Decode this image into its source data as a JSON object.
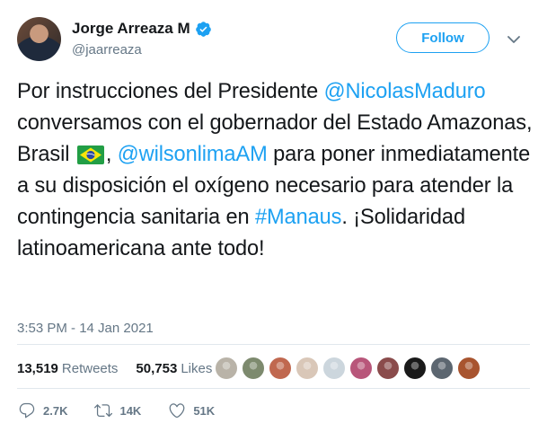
{
  "user": {
    "name": "Jorge Arreaza M",
    "handle": "@jaarreaza",
    "verified": true
  },
  "follow_button": {
    "label": "Follow"
  },
  "tweet": {
    "segments": [
      {
        "text": "Por instrucciones del Presidente ",
        "type": "text"
      },
      {
        "text": "@NicolasMaduro",
        "type": "mention"
      },
      {
        "text": " conversamos con el gobernador del Estado Amazonas, Brasil ",
        "type": "text"
      },
      {
        "text": "",
        "type": "flag-brazil"
      },
      {
        "text": ", ",
        "type": "text"
      },
      {
        "text": "@wilsonlimaAM",
        "type": "mention"
      },
      {
        "text": " para poner inmediatamente a su disposición el oxígeno necesario para atender la contingencia sanitaria en ",
        "type": "text"
      },
      {
        "text": "#Manaus",
        "type": "hashtag"
      },
      {
        "text": ". ¡Solidaridad latinoamericana ante todo!",
        "type": "text"
      }
    ],
    "timestamp": "3:53 PM - 14 Jan 2021"
  },
  "stats": {
    "retweets_count": "13,519",
    "retweets_label": "Retweets",
    "likes_count": "50,753",
    "likes_label": "Likes"
  },
  "liker_avatar_colors": [
    "#b9b3a8",
    "#7d8a6e",
    "#c0684f",
    "#d9c7b8",
    "#ccd6dd",
    "#b8567a",
    "#8a4b4b",
    "#1a1a1a",
    "#5c6670",
    "#a8542f"
  ],
  "actions": {
    "replies": "2.7K",
    "retweets": "14K",
    "likes": "51K"
  },
  "colors": {
    "accent": "#1da1f2",
    "text": "#14171a",
    "muted": "#657786",
    "divider": "#e1e8ed"
  }
}
